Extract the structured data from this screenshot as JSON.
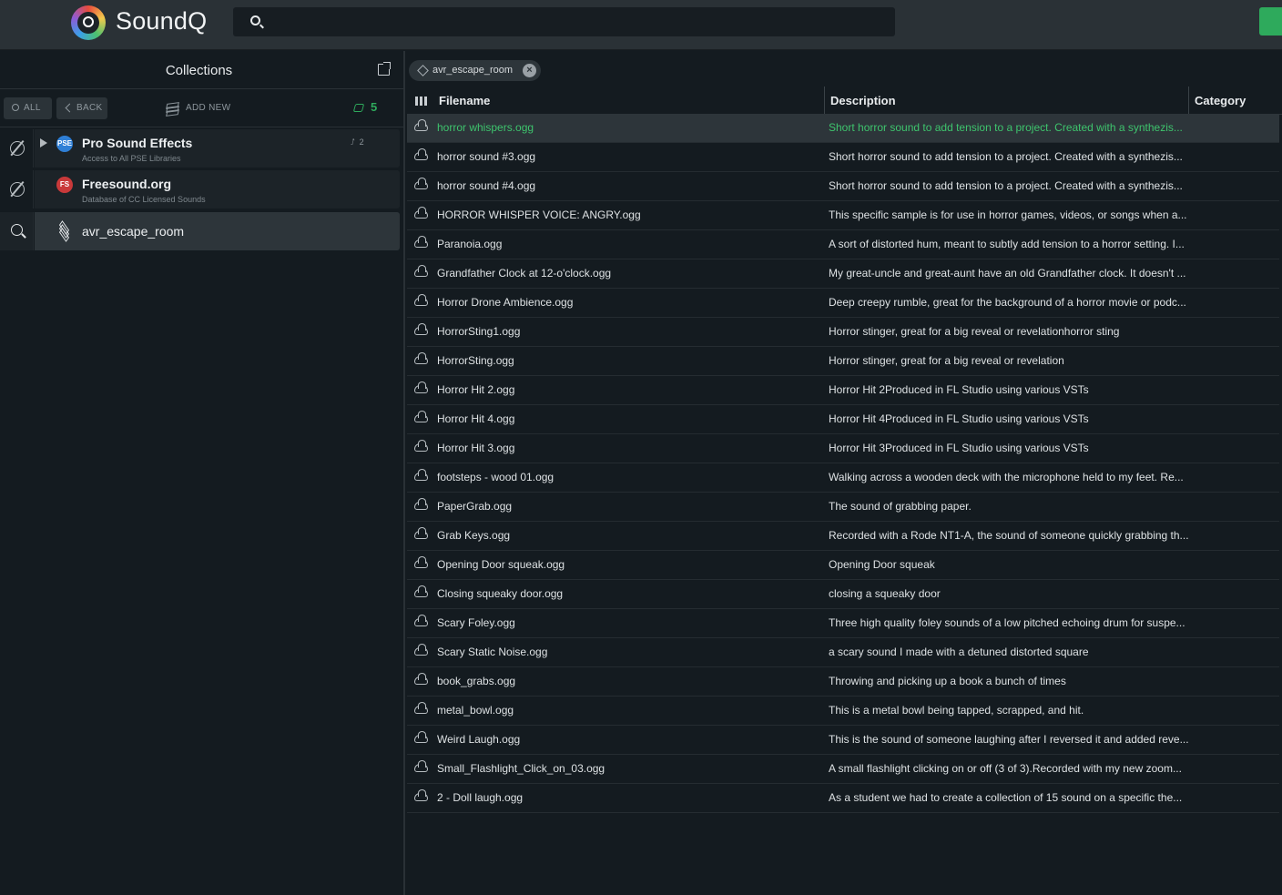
{
  "app": {
    "name": "SoundQ"
  },
  "search": {
    "placeholder": "",
    "value": ""
  },
  "sidebar": {
    "title": "Collections",
    "tools": {
      "all_label": "ALL",
      "back_label": "BACK",
      "add_new_label": "ADD NEW",
      "count": "5"
    },
    "collections": [
      {
        "name": "Pro Sound Effects",
        "subtitle": "Access to All PSE Libraries",
        "badge": "PSE",
        "count": "2"
      },
      {
        "name": "Freesound.org",
        "subtitle": "Database of CC Licensed Sounds",
        "badge": "FS"
      },
      {
        "name": "avr_escape_room"
      }
    ]
  },
  "main": {
    "filter_chip": "avr_escape_room",
    "columns": {
      "filename": "Filename",
      "description": "Description",
      "category": "Category"
    },
    "rows": [
      {
        "filename": "horror whispers.ogg",
        "description": "Short horror sound to add tension to a project. Created with a synthezis..."
      },
      {
        "filename": "horror sound #3.ogg",
        "description": "Short horror sound to add tension to a project. Created with a synthezis..."
      },
      {
        "filename": "horror sound #4.ogg",
        "description": "Short horror sound to add tension to a project. Created with a synthezis..."
      },
      {
        "filename": "HORROR WHISPER VOICE: ANGRY.ogg",
        "description": "This specific sample is for use in horror games, videos, or songs when a..."
      },
      {
        "filename": "Paranoia.ogg",
        "description": "A sort of distorted hum, meant to subtly add tension to a horror setting. I..."
      },
      {
        "filename": "Grandfather Clock at 12-o'clock.ogg",
        "description": "My great-uncle and great-aunt have an old Grandfather clock. It doesn't ..."
      },
      {
        "filename": "Horror Drone Ambience.ogg",
        "description": "Deep creepy rumble, great for the background of a horror movie or podc..."
      },
      {
        "filename": "HorrorSting1.ogg",
        "description": "Horror stinger, great for a big reveal or revelationhorror sting"
      },
      {
        "filename": "HorrorSting.ogg",
        "description": "Horror stinger, great for a big reveal or revelation"
      },
      {
        "filename": "Horror Hit 2.ogg",
        "description": "Horror Hit 2Produced in FL Studio using various VSTs"
      },
      {
        "filename": "Horror Hit 4.ogg",
        "description": "Horror Hit 4Produced in FL Studio using various VSTs"
      },
      {
        "filename": "Horror Hit 3.ogg",
        "description": "Horror Hit 3Produced in FL Studio using various VSTs"
      },
      {
        "filename": "footsteps - wood 01.ogg",
        "description": "Walking across a wooden deck with the microphone held to my feet.  Re..."
      },
      {
        "filename": "PaperGrab.ogg",
        "description": "The sound of grabbing paper."
      },
      {
        "filename": "Grab Keys.ogg",
        "description": "Recorded with a Rode NT1-A, the sound of someone quickly grabbing th..."
      },
      {
        "filename": "Opening Door squeak.ogg",
        "description": "Opening Door squeak"
      },
      {
        "filename": "Closing squeaky door.ogg",
        "description": "closing a squeaky door"
      },
      {
        "filename": "Scary Foley.ogg",
        "description": "Three high quality foley sounds of a low pitched echoing drum for suspe..."
      },
      {
        "filename": "Scary Static Noise.ogg",
        "description": "a scary sound I made with a detuned distorted square"
      },
      {
        "filename": "book_grabs.ogg",
        "description": "Throwing and picking up a book a bunch of times"
      },
      {
        "filename": "metal_bowl.ogg",
        "description": "This is a metal bowl being tapped, scrapped, and hit."
      },
      {
        "filename": "Weird Laugh.ogg",
        "description": "This is the sound of someone laughing after I reversed it and added reve..."
      },
      {
        "filename": "Small_Flashlight_Click_on_03.ogg",
        "description": "A small flashlight clicking on or off (3 of 3).Recorded with my new zoom..."
      },
      {
        "filename": "2 - Doll laugh.ogg",
        "description": "As a student we had to create a collection of 15 sound on a specific the..."
      }
    ]
  },
  "colors": {
    "accent": "#2eaa5c",
    "highlight_text": "#3ec46d",
    "background": "#141b20",
    "topbar": "#2a3136"
  }
}
